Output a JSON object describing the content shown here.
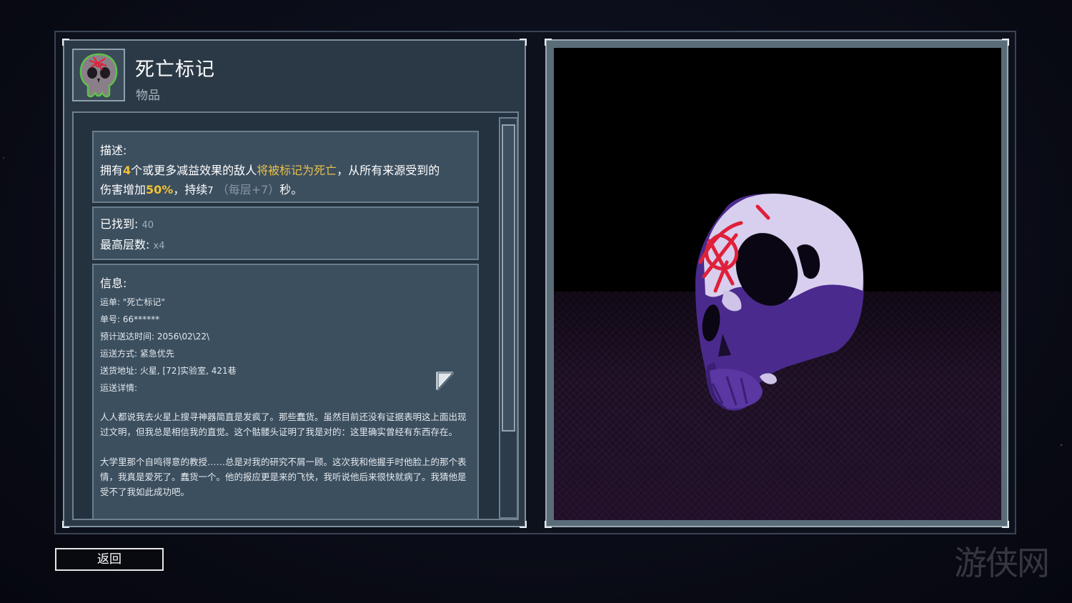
{
  "item": {
    "title": "死亡标记",
    "type": "物品",
    "icon": "skull-icon"
  },
  "description": {
    "heading": "描述:",
    "part1": "拥有",
    "count": "4",
    "part2": "个或更多减益效果的敌人",
    "marked": "将被标记为死亡",
    "part3": "，从所有来源受到的",
    "part4": "伤害增加",
    "percent": "50%",
    "part5": "，持续",
    "duration": "7",
    "per_stack": "（每层+7）",
    "part6": "秒。"
  },
  "stats": {
    "found_label": "已找到:",
    "found_value": "40",
    "max_label": "最高层数:",
    "max_value": "x4"
  },
  "info": {
    "heading": "信息:",
    "lines": [
      "运单: \"死亡标记\"",
      "单号: 66******",
      "预计送达时间: 2056\\02\\22\\",
      "运送方式: 紧急优先",
      "送货地址: 火星, [72]实验室, 421巷",
      "运送详情:"
    ],
    "para1": "人人都说我去火星上搜寻神器简直是发疯了。那些蠢货。虽然目前还没有证据表明这上面出现过文明，但我总是相信我的直觉。这个骷髅头证明了我是对的：这里确实曾经有东西存在。",
    "para2": "大学里那个自鸣得意的教授……总是对我的研究不屑一顾。这次我和他握手时他脸上的那个表情，我真是爱死了。蠢货一个。他的报应更是来的飞快，我听说他后来很快就病了。我猜他是受不了我如此成功吧。"
  },
  "buttons": {
    "back": "返回"
  },
  "watermark": "游侠网",
  "colors": {
    "highlight_yellow": "#f1c232",
    "highlight_gold": "#e9c04a",
    "panel": "#2b3947",
    "skull_purple": "#4a2a8a",
    "skull_light": "#d9d0ee",
    "mark_red": "#e0203a"
  }
}
